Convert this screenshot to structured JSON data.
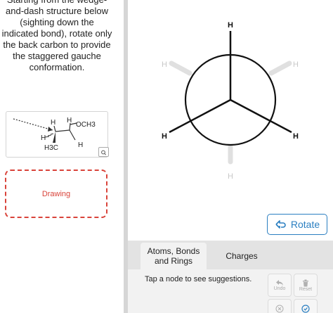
{
  "instructions": {
    "lines": [
      "Starting from the wedge-",
      "and-dash structure below",
      "(sighting down the",
      "indicated bond), rotate only",
      "the back carbon to provide",
      "the staggered gauche",
      "conformation."
    ]
  },
  "structure": {
    "labels": {
      "h_top": "H",
      "h_right": "H",
      "och3": "OCH3",
      "h_left": "H",
      "h3c": "H3C",
      "h_bottom": "H"
    }
  },
  "drawing": {
    "label": "Drawing"
  },
  "newman": {
    "front_labels": {
      "top": "H",
      "left": "H",
      "right": "H"
    },
    "back_labels": {
      "upper_left": "H",
      "upper_right": "H",
      "bottom": "H"
    }
  },
  "rotate_label": "Rotate",
  "tabs": [
    {
      "line1": "Atoms, Bonds",
      "line2": "and Rings"
    },
    {
      "label": "Charges"
    }
  ],
  "hint": "Tap a node to see suggestions.",
  "actions": {
    "undo": "Undo",
    "reset": "Reset"
  },
  "colors": {
    "accent": "#2b7fc1",
    "error": "#d9433a",
    "ghost": "#c8c8c8"
  }
}
